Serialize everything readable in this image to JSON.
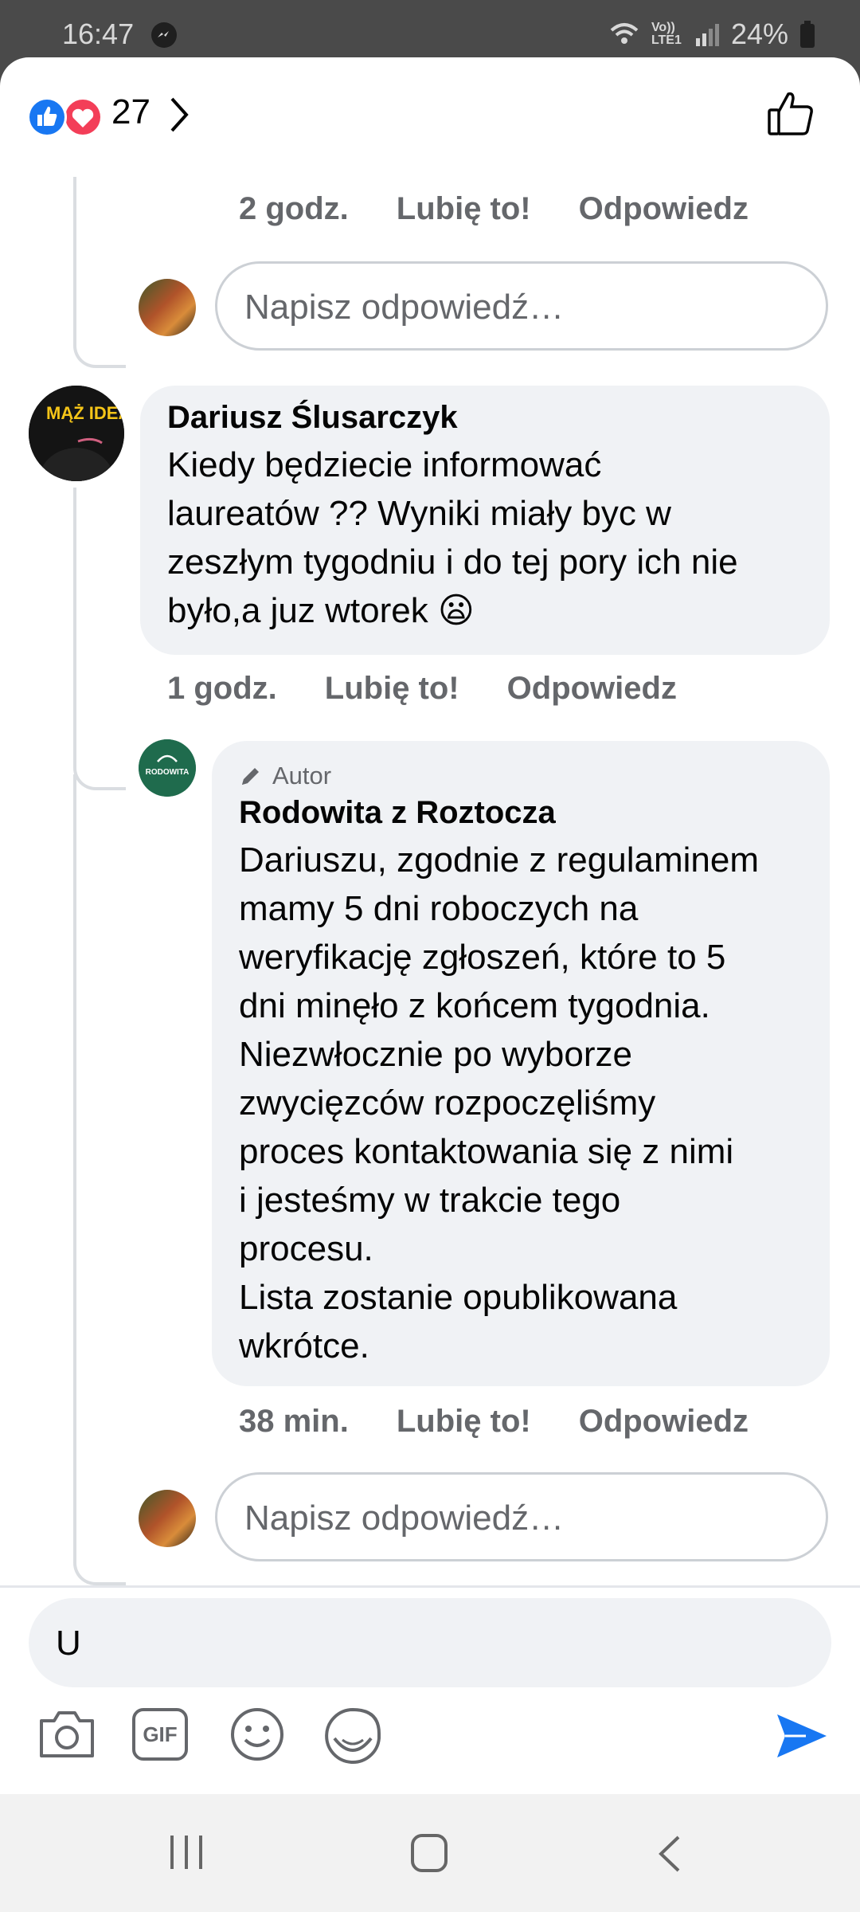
{
  "status_bar": {
    "time": "16:47",
    "network": "Vo)) LTE1",
    "battery": "24%"
  },
  "header": {
    "reaction_count": "27"
  },
  "comments": [
    {
      "meta": {
        "time": "2 godz.",
        "like": "Lubię to!",
        "reply": "Odpowiedz"
      }
    },
    {
      "reply_placeholder": "Napisz odpowiedź…"
    },
    {
      "author": "Dariusz Ślusarczyk",
      "text": "Kiedy będziecie informować\nlaureatów ?? Wyniki miały byc w\nzeszłym tygodniu i do tej pory ich nie\nbyło,a juz wtorek 😦",
      "meta": {
        "time": "1 godz.",
        "like": "Lubię to!",
        "reply": "Odpowiedz"
      },
      "avatar_text": "MĄŻ IDEALNY"
    },
    {
      "badge": "Autor",
      "author": "Rodowita z Roztocza",
      "text": "Dariuszu, zgodnie z regulaminem\nmamy 5 dni roboczych na\nweryfikację zgłoszeń, które to 5\ndni minęło z końcem tygodnia.\nNiezwłocznie po wyborze\nzwycięzców rozpoczęliśmy\nproces kontaktowania się z nimi\ni jesteśmy w trakcie tego\nprocesu.\nLista zostanie opublikowana\nwkrótce.",
      "meta": {
        "time": "38 min.",
        "like": "Lubię to!",
        "reply": "Odpowiedz"
      },
      "avatar_text": "RODOWITA"
    },
    {
      "reply_placeholder": "Napisz odpowiedź…"
    }
  ],
  "composer": {
    "value": "U",
    "gif_label": "GIF"
  },
  "colors": {
    "accent": "#1877f2",
    "like_blue": "#1877f2",
    "love_red": "#f33e58",
    "bubble": "#f0f2f5",
    "meta_gray": "#65676b"
  },
  "icons": [
    "messenger-icon",
    "wifi-icon",
    "signal-icon",
    "battery-icon",
    "like-reaction-icon",
    "love-reaction-icon",
    "chevron-right-icon",
    "thumbs-up-icon",
    "pencil-icon",
    "camera-icon",
    "gif-icon",
    "emoji-icon",
    "sticker-icon",
    "send-icon",
    "recents-icon",
    "home-icon",
    "back-icon"
  ]
}
